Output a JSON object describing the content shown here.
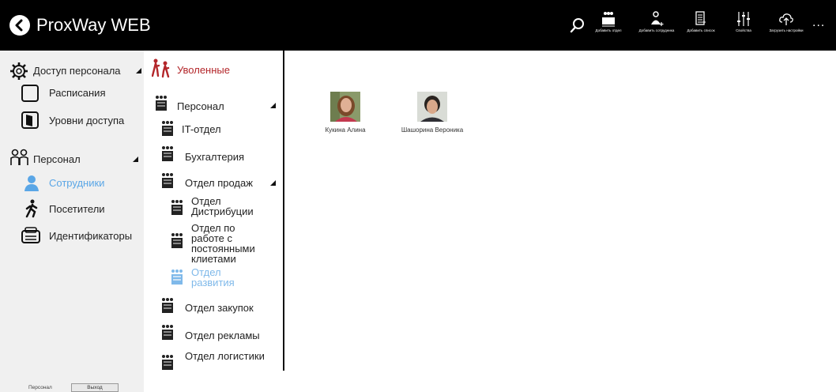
{
  "app": {
    "title": "ProxWay WEB"
  },
  "toolbar": {
    "search_icon": "search-icon",
    "buttons": [
      {
        "label": "Добавить отдел",
        "icon": "add-department-icon"
      },
      {
        "label": "Добавить сотрудника",
        "icon": "add-employee-icon"
      },
      {
        "label": "Добавить список",
        "icon": "add-list-icon"
      },
      {
        "label": "Свойства",
        "icon": "properties-sliders-icon"
      },
      {
        "label": "Загрузить настройки",
        "icon": "upload-cloud-icon"
      }
    ],
    "more_label": "..."
  },
  "nav": {
    "sections": [
      {
        "label": "Доступ персонала",
        "icon": "gear-icon"
      },
      {
        "label": "Персонал",
        "icon": "people-icon"
      }
    ],
    "items": [
      {
        "label": "Расписания",
        "icon": "calendar-icon"
      },
      {
        "label": "Уровни доступа",
        "icon": "door-icon"
      },
      {
        "label": "Сотрудники",
        "icon": "user-icon",
        "active": true
      },
      {
        "label": "Посетители",
        "icon": "walker-icon"
      },
      {
        "label": "Идентификаторы",
        "icon": "id-card-icon"
      }
    ],
    "footer": {
      "label": "Персонал",
      "button": "Выход"
    }
  },
  "tree": {
    "header": "Уволенные",
    "items": [
      {
        "label": "Персонал",
        "expandable": true
      },
      {
        "label": "IT-отдел"
      },
      {
        "label": "Бухгалтерия"
      },
      {
        "label": "Отдел продаж",
        "expandable": true
      },
      {
        "label": "Отдел Дистрибуции"
      },
      {
        "label": "Отдел по работе с постоянными клиетами"
      },
      {
        "label": "Отдел развития",
        "active": true
      },
      {
        "label": "Отдел закупок"
      },
      {
        "label": "Отдел рекламы"
      },
      {
        "label": "Отдел логистики"
      }
    ]
  },
  "employees": [
    {
      "name": "Кукина Алина"
    },
    {
      "name": "Шашорина Вероника"
    }
  ],
  "colors": {
    "topbar": "#000000",
    "accent": "#5aa6e6",
    "header_red": "#b3262a",
    "nav_bg": "#f0f0f0"
  }
}
